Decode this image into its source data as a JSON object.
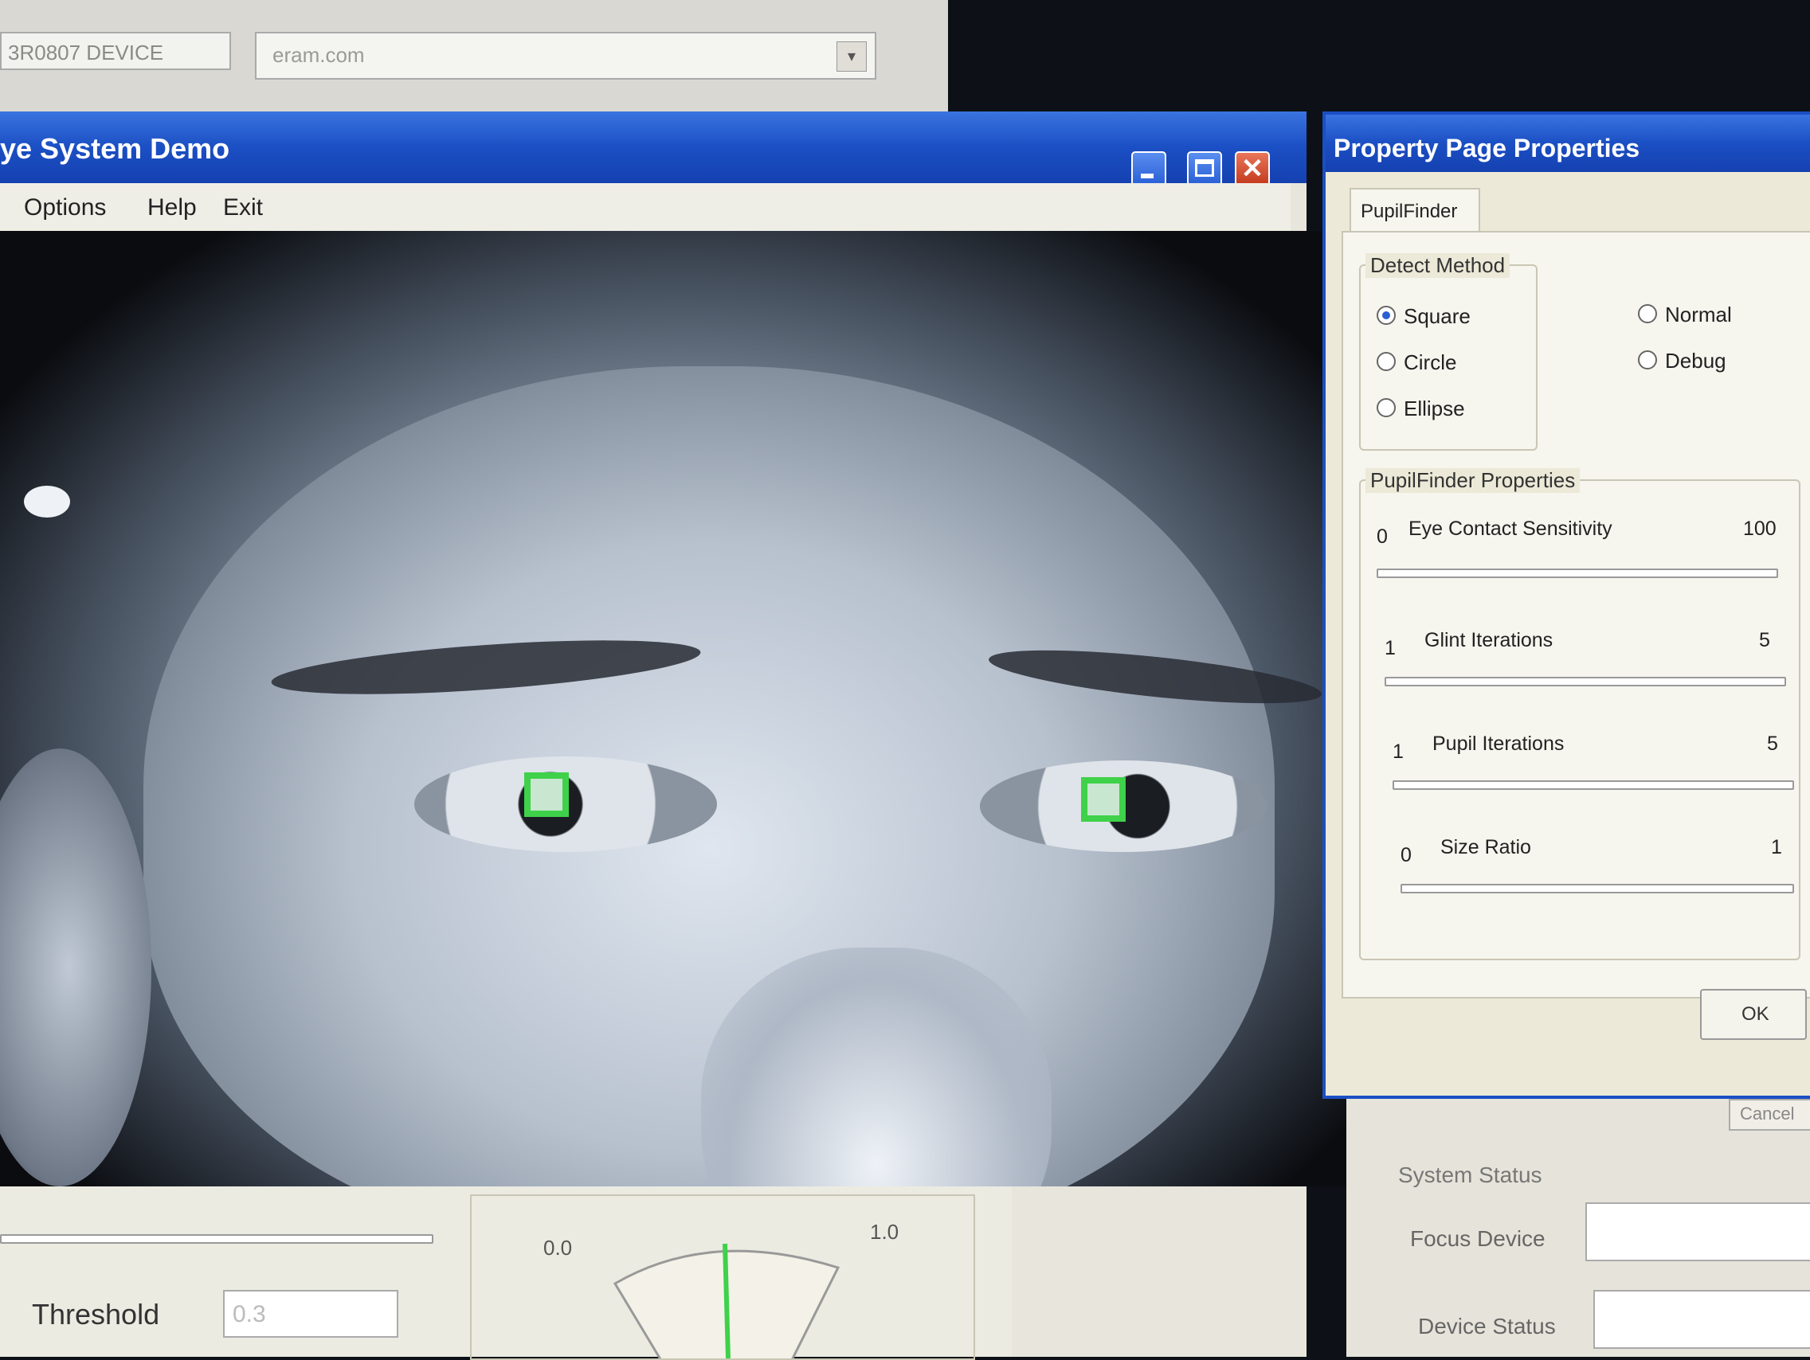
{
  "background_window": {
    "field_value": "3R0807 DEVICE",
    "dropdown_value": "eram.com"
  },
  "main_window": {
    "title": "ye System Demo",
    "menu": [
      "Options",
      "Help",
      "Exit"
    ],
    "bottom": {
      "threshold_label": "Threshold",
      "threshold_value": "0.3",
      "gauge_min": "0.0",
      "gauge_max": "1.0"
    }
  },
  "property_window": {
    "title": "Property Page Properties",
    "tab": "PupilFinder",
    "detect_method": {
      "label": "Detect Method",
      "options": [
        "Square",
        "Circle",
        "Ellipse"
      ],
      "selected": "Square"
    },
    "mode": {
      "options": [
        "Normal",
        "Debug"
      ]
    },
    "properties": {
      "label": "PupilFinder Properties",
      "sliders": [
        {
          "label": "Eye Contact Sensitivity",
          "min": "0",
          "max": "100"
        },
        {
          "label": "Glint Iterations",
          "min": "1",
          "max": "5"
        },
        {
          "label": "Pupil Iterations",
          "min": "1",
          "max": "5"
        },
        {
          "label": "Size Ratio",
          "min": "0",
          "max": "1"
        }
      ]
    },
    "ok_label": "OK",
    "cancel_label": "Cancel"
  },
  "system_status": {
    "label": "System Status",
    "focus_device_label": "Focus Device",
    "device_status_label": "Device Status"
  },
  "colors": {
    "title_blue": "#1b4fc4",
    "marker_green": "#3fd14a",
    "dialog_bg": "#ece9d8"
  }
}
